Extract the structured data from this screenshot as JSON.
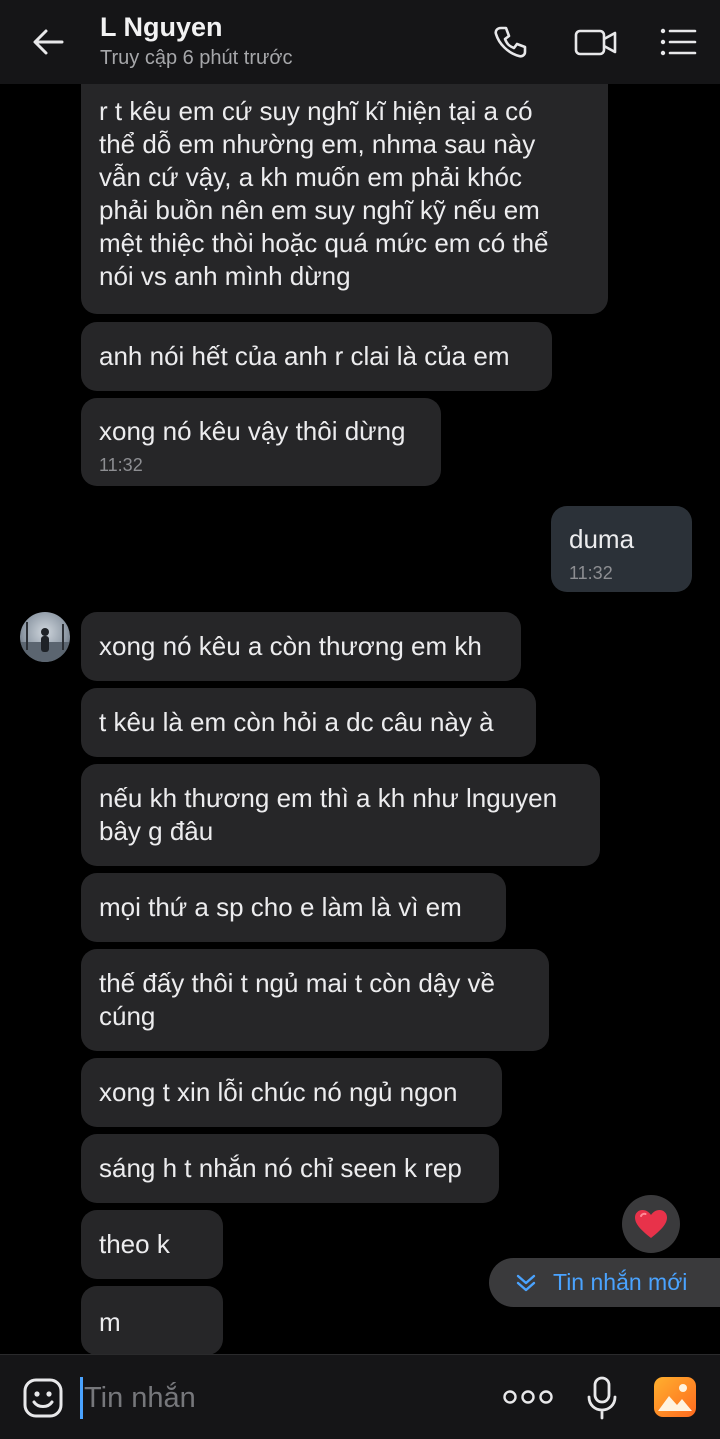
{
  "header": {
    "contact_name": "L Nguyen",
    "status": "Truy cập 6 phút trước",
    "icons": [
      "back-arrow-icon",
      "phone-icon",
      "video-call-icon",
      "menu-list-icon"
    ]
  },
  "messages": [
    {
      "text": "r t kêu em cứ suy nghĩ kĩ hiện tại a có\nthể dỗ em nhường em, nhma sau này\nvẫn cứ vậy, a kh muốn em phải khóc\nphải buồn nên em suy nghĩ kỹ nếu em\nmệt thiệc thòi hoặc quá mức em có thể\nnói vs anh mình dừng"
    },
    {
      "text": "anh nói hết của anh r clai là của em"
    },
    {
      "text": "xong nó kêu vậy thôi dừng",
      "time": "11:32"
    },
    {
      "text": "duma",
      "time": "11:32"
    },
    {
      "text": "xong nó kêu a còn thương em kh"
    },
    {
      "text": "t kêu là em còn hỏi a dc câu này à"
    },
    {
      "text": "nếu kh thương em thì a kh như lnguyen\nbây g đâu"
    },
    {
      "text": "mọi thứ a sp cho e làm là vì em"
    },
    {
      "text": "thế đấy thôi t ngủ mai t còn dậy về\ncúng"
    },
    {
      "text": "xong t xin lỗi chúc nó ngủ ngon"
    },
    {
      "text": "sáng h t nhắn nó chỉ seen k rep"
    },
    {
      "text": "theo k"
    },
    {
      "text": "m"
    }
  ],
  "new_message_button": {
    "label": "Tin nhắn mới"
  },
  "composer": {
    "placeholder": "Tin nhắn"
  },
  "colors": {
    "accent": "#4aa3ff",
    "bubble": "#262628",
    "my_bubble": "#2b3138",
    "heart": "#e8324a"
  }
}
